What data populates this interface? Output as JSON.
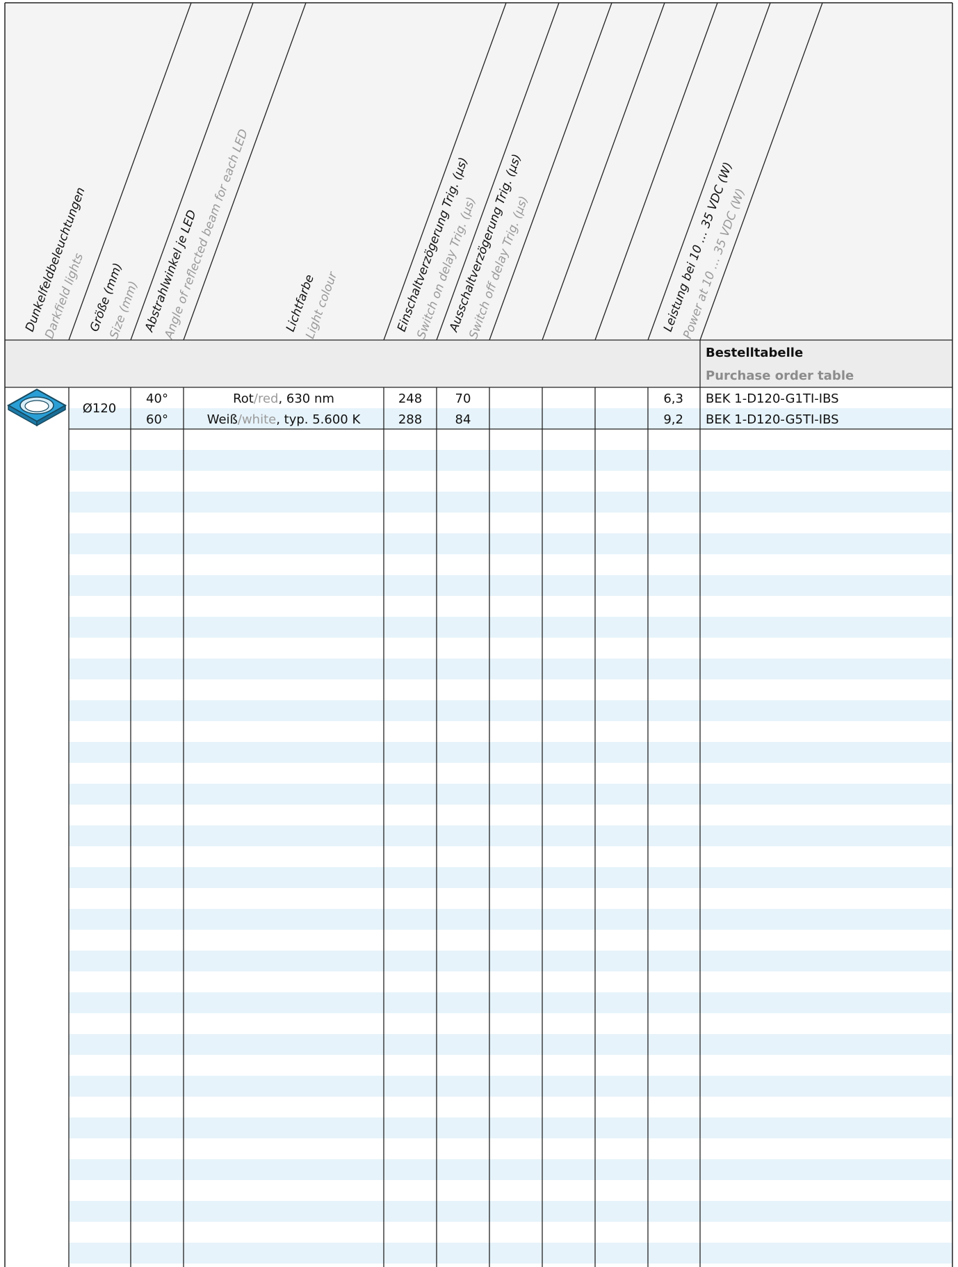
{
  "columns": [
    {
      "main": "Dunkelfeldbeleuchtungen",
      "sub": "Darkfield lights"
    },
    {
      "main": "Größe (mm)",
      "sub": "Size (mm)"
    },
    {
      "main": "Abstrahlwinkel je LED",
      "sub": "Angle of reflected beam for each LED"
    },
    {
      "main": "Lichtfarbe",
      "sub": "Light colour"
    },
    {
      "main": "Einschaltverzögerung Trig. (µs)",
      "sub": "Switch on delay Trig. (µs)"
    },
    {
      "main": "Ausschaltverzögerung Trig. (µs)",
      "sub": "Switch off delay Trig. (µs)"
    },
    {
      "main": "",
      "sub": ""
    },
    {
      "main": "",
      "sub": ""
    },
    {
      "main": "",
      "sub": ""
    },
    {
      "main": "Leistung bei 10 … 35 VDC (W)",
      "sub": "Power at 10 … 35 VDC (W)"
    },
    {
      "main": "",
      "sub": ""
    }
  ],
  "order_table": {
    "title": "Bestelltabelle",
    "subtitle": "Purchase order table"
  },
  "product": {
    "icon": "ring-light-icon",
    "size": "Ø120",
    "rows": [
      {
        "angle": "40°",
        "colour_de": "Rot",
        "sep": "/",
        "colour_en": "red",
        "colour_rest": ", 630 nm",
        "on_delay": "248",
        "off_delay": "70",
        "power": "6,3",
        "order_no": "BEK 1-D120-G1TI-IBS"
      },
      {
        "angle": "60°",
        "colour_de": "Weiß",
        "sep": "/",
        "colour_en": "white",
        "colour_rest": ", typ. 5.600 K",
        "on_delay": "288",
        "off_delay": "84",
        "power": "9,2",
        "order_no": "BEK 1-D120-G5TI-IBS"
      }
    ]
  },
  "colors": {
    "header_bg": "#f4f4f4",
    "row_stripe": "#e6f3fa",
    "icon_blue": "#2a9fd6",
    "grey_text": "#9a9a9a"
  }
}
